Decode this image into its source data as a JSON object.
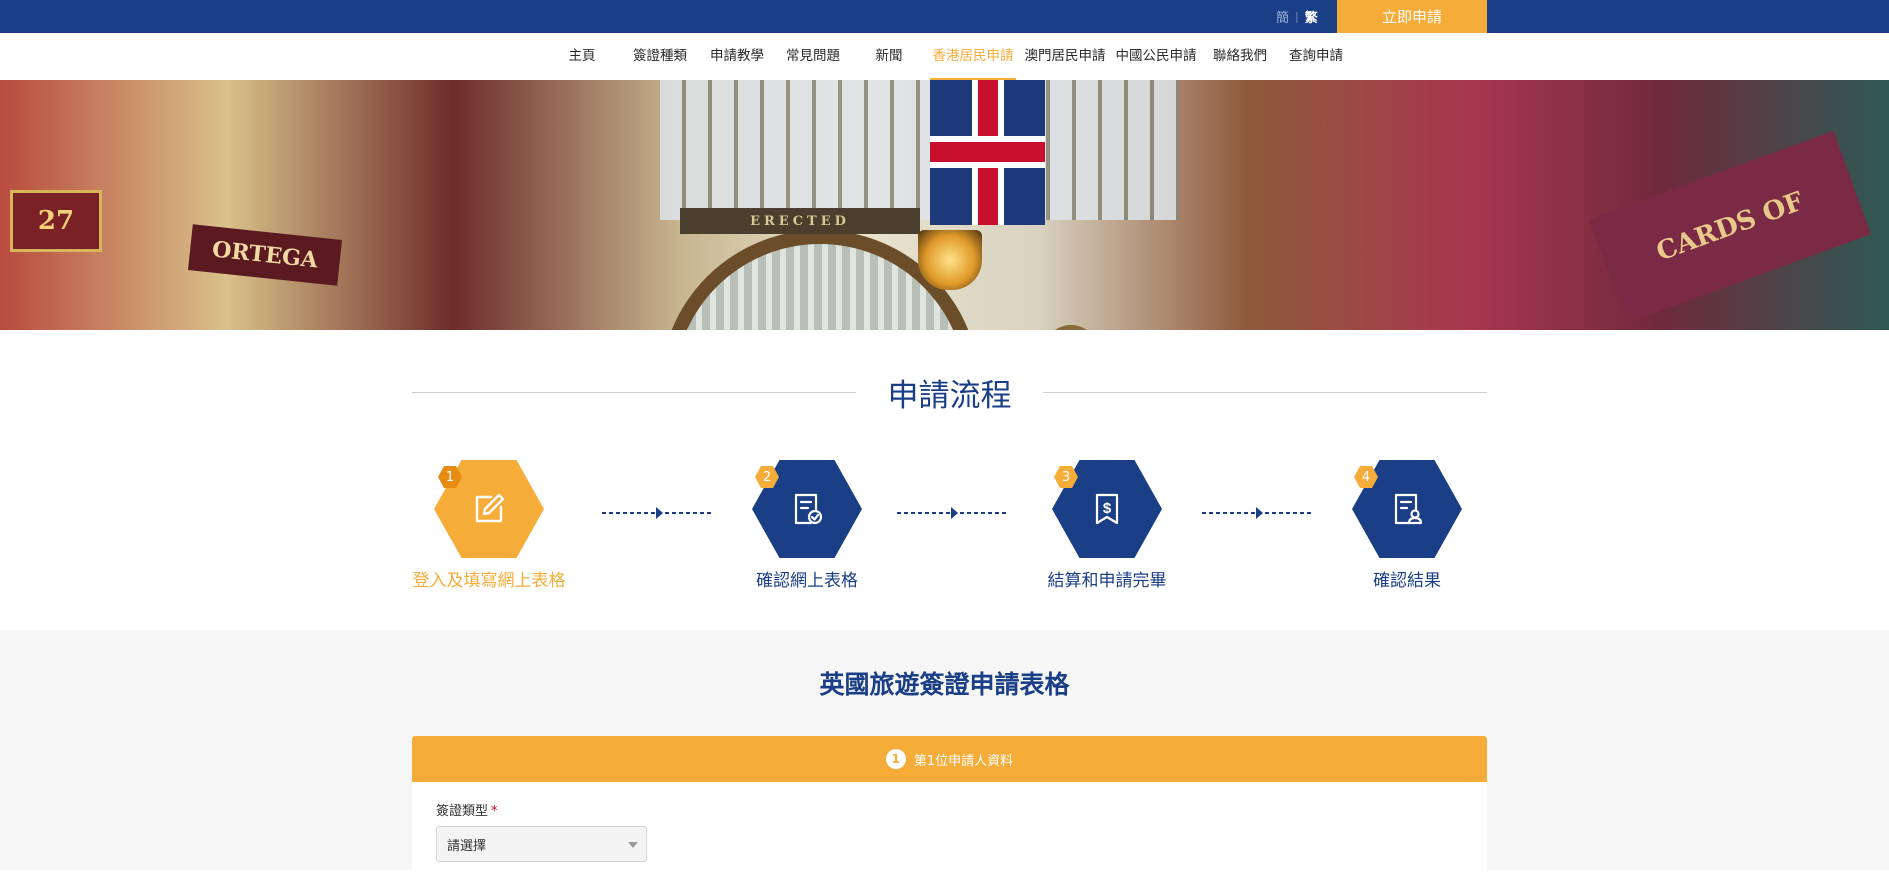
{
  "topbar": {
    "lang_simplified": "簡",
    "lang_separator": "|",
    "lang_traditional": "繁",
    "apply_button": "立即申請"
  },
  "nav": {
    "items": [
      "主頁",
      "簽證種類",
      "申請教學",
      "常見問題",
      "新聞",
      "香港居民申請",
      "澳門居民申請",
      "中國公民申請",
      "聯絡我們",
      "查詢申請"
    ],
    "active_index": 5
  },
  "hero": {
    "sign_27": "27",
    "sign_ortega": "ORTEGA",
    "sign_cards": "CARDS OF",
    "sign_erected": "ERECTED"
  },
  "process": {
    "title": "申請流程",
    "steps": [
      {
        "number": "1",
        "label": "登入及填寫網上表格",
        "icon": "edit-icon",
        "active": true
      },
      {
        "number": "2",
        "label": "確認網上表格",
        "icon": "document-check-icon",
        "active": false
      },
      {
        "number": "3",
        "label": "結算和申請完畢",
        "icon": "payment-document-icon",
        "active": false
      },
      {
        "number": "4",
        "label": "確認結果",
        "icon": "document-user-icon",
        "active": false
      }
    ]
  },
  "form": {
    "title": "英國旅遊簽證申請表格",
    "section_number": "1",
    "section_title": "第1位申請人資料",
    "visa_type_label": "簽證類型",
    "required_mark": "*",
    "visa_type_value": "請選擇"
  },
  "colors": {
    "primary": "#1a3f87",
    "accent": "#f6ac39"
  }
}
